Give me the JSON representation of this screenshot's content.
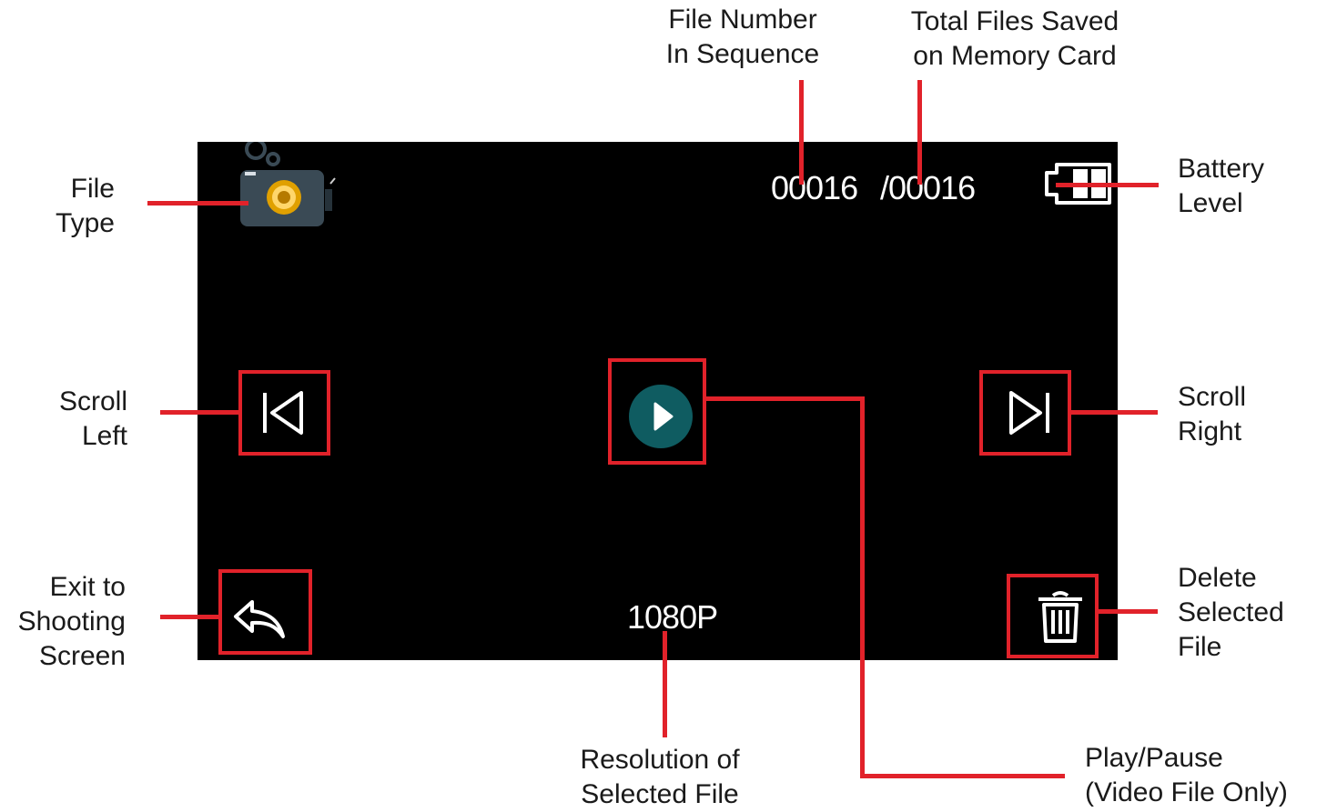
{
  "labels": {
    "file_number": [
      "File Number",
      "In Sequence"
    ],
    "total_files": [
      "Total Files Saved",
      "on Memory Card"
    ],
    "file_type": [
      "File",
      "Type"
    ],
    "battery": [
      "Battery",
      "Level"
    ],
    "scroll_left": [
      "Scroll",
      "Left"
    ],
    "scroll_right": [
      "Scroll",
      "Right"
    ],
    "exit": [
      "Exit to",
      "Shooting",
      "Screen"
    ],
    "delete": [
      "Delete",
      "Selected",
      "File"
    ],
    "resolution": [
      "Resolution of",
      "Selected File"
    ],
    "play_pause": [
      "Play/Pause",
      "(Video File Only)"
    ]
  },
  "screen": {
    "file_number": "00016",
    "total_files": "/00016",
    "resolution": "1080P"
  },
  "icons": {
    "file_type": "camera-icon",
    "battery": "battery-icon",
    "scroll_left": "skip-previous-icon",
    "scroll_right": "skip-next-icon",
    "play": "play-icon",
    "exit": "back-arrow-icon",
    "delete": "trash-icon"
  },
  "colors": {
    "callout": "#e1222a",
    "screen": "#000000",
    "play_button": "#0f5c61",
    "camera_body": "#3a4a55",
    "lens": "#e0a000"
  }
}
